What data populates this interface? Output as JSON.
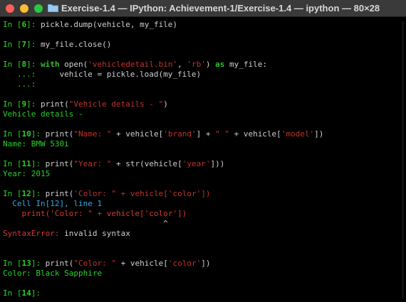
{
  "window": {
    "title": "Exercise-1.4 — IPython: Achievement-1/Exercise-1.4 — ipython — 80×28"
  },
  "terminal": {
    "l1": {
      "prompt_open": "In [",
      "num": "6",
      "prompt_close": "]: ",
      "code": "pickle.dump(vehicle, my_file)"
    },
    "l2": {
      "prompt_open": "In [",
      "num": "7",
      "prompt_close": "]: ",
      "code": "my_file.close()"
    },
    "l3": {
      "prompt_open": "In [",
      "num": "8",
      "prompt_close": "]: ",
      "kw1": "with",
      "c1": " open(",
      "str1": "'vehicledetail.bin'",
      "c2": ", ",
      "str2": "'rb'",
      "c3": ") ",
      "kw2": "as",
      "c4": " my_file:"
    },
    "l4": {
      "cont": "   ...:",
      "code": "     vehicle = pickle.load(my_file)"
    },
    "l5": {
      "cont": "   ...:"
    },
    "l6": {
      "prompt_open": "In [",
      "num": "9",
      "prompt_close": "]: ",
      "c1": "print(",
      "str1": "\"Vehicle details - \"",
      "c2": ")"
    },
    "l7": {
      "out": "Vehicle details -"
    },
    "l8": {
      "prompt_open": "In [",
      "num": "10",
      "prompt_close": "]: ",
      "c1": "print(",
      "str1": "\"Name: \"",
      "c2": " + vehicle[",
      "str2": "'brand'",
      "c3": "] + ",
      "str3": "\" \"",
      "c4": " + vehicle[",
      "str4": "'model'",
      "c5": "])"
    },
    "l9": {
      "out": "Name: BMW 530i"
    },
    "l10": {
      "prompt_open": "In [",
      "num": "11",
      "prompt_close": "]: ",
      "c1": "print(",
      "str1": "\"Year: \"",
      "c2": " + str(vehicle[",
      "str2": "'year'",
      "c3": "]))"
    },
    "l11": {
      "out": "Year: 2015"
    },
    "l12": {
      "prompt_open": "In [",
      "num": "12",
      "prompt_close": "]: ",
      "c1": "print(",
      "str1": "'Color: \" + vehicle['",
      "c2": "color",
      "str2": "'])"
    },
    "l13": {
      "cell": "  Cell In[12], line 1"
    },
    "l14": {
      "code": "    print('Color: \" + vehicle['color'])"
    },
    "l15": {
      "caret": "                                  ^"
    },
    "l16": {
      "err": "SyntaxError:",
      "msg": " invalid syntax"
    },
    "l17": {
      "prompt_open": "In [",
      "num": "13",
      "prompt_close": "]: ",
      "c1": "print(",
      "str1": "\"Color: \"",
      "c2": " + vehicle[",
      "str2": "'color'",
      "c3": "])"
    },
    "l18": {
      "out": "Color: Black Sapphire"
    },
    "l19": {
      "prompt_open": "In [",
      "num": "14",
      "prompt_close": "]: "
    }
  }
}
